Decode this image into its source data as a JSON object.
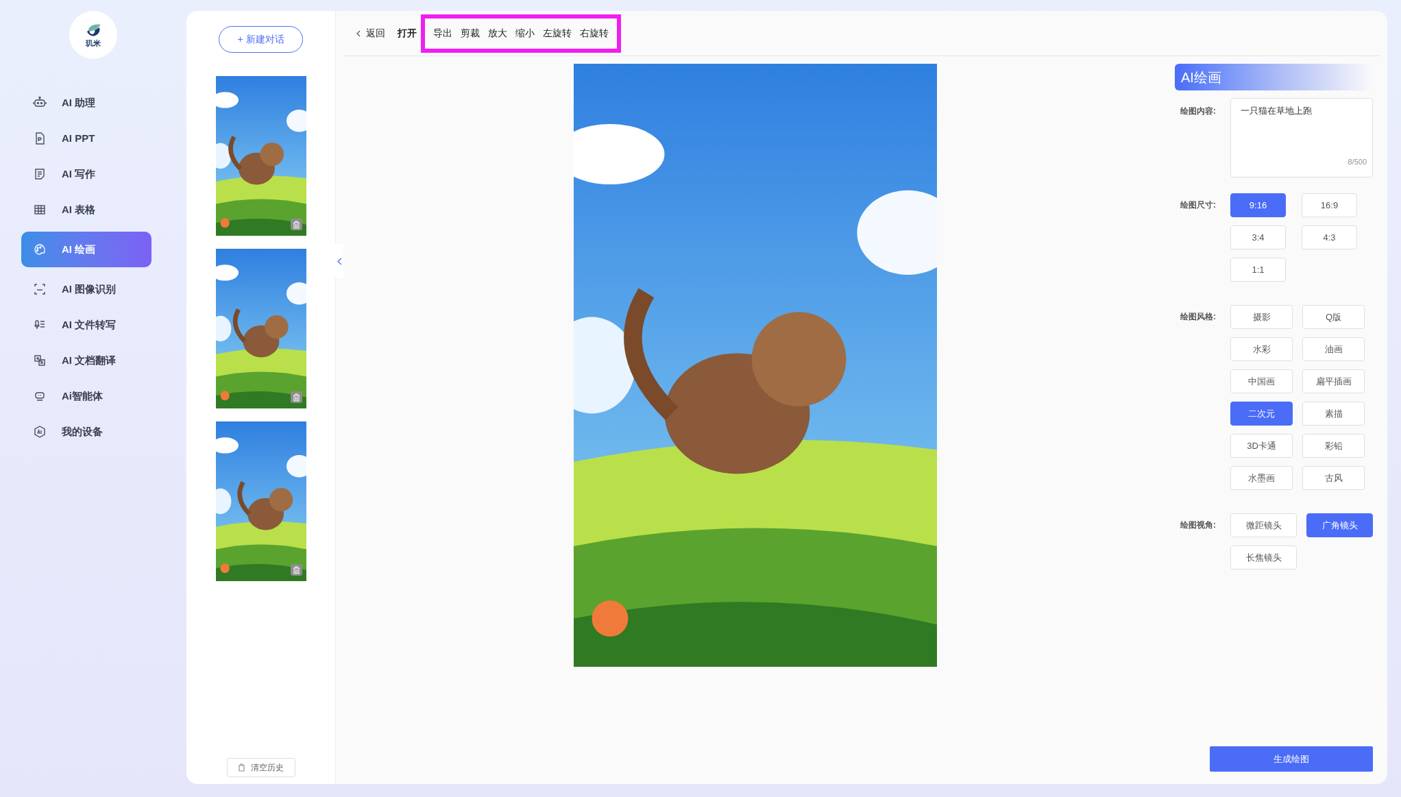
{
  "logo": {
    "text": "玑米"
  },
  "sidebar": {
    "items": [
      {
        "label": "AI 助理",
        "selected": false
      },
      {
        "label": "AI PPT",
        "selected": false
      },
      {
        "label": "AI 写作",
        "selected": false
      },
      {
        "label": "AI 表格",
        "selected": false
      },
      {
        "label": "AI 绘画",
        "selected": true
      },
      {
        "label": "AI 图像识别",
        "selected": false
      },
      {
        "label": "AI 文件转写",
        "selected": false
      },
      {
        "label": "AI 文档翻译",
        "selected": false
      },
      {
        "label": "Ai智能体",
        "selected": false
      },
      {
        "label": "我的设备",
        "selected": false
      }
    ]
  },
  "history": {
    "new_chat": "+ 新建对话",
    "clear": "清空历史"
  },
  "toolbar": {
    "back": "返回",
    "items": [
      {
        "label": "打开",
        "bold": true,
        "highlighted": false
      },
      {
        "label": "导出",
        "bold": false,
        "highlighted": true
      },
      {
        "label": "剪裁",
        "bold": false,
        "highlighted": true
      },
      {
        "label": "放大",
        "bold": false,
        "highlighted": true
      },
      {
        "label": "缩小",
        "bold": false,
        "highlighted": true
      },
      {
        "label": "左旋转",
        "bold": false,
        "highlighted": true
      },
      {
        "label": "右旋转",
        "bold": false,
        "highlighted": true
      }
    ]
  },
  "panel": {
    "title": "AI绘画",
    "content": {
      "label": "绘图内容:",
      "value": "一只猫在草地上跑",
      "counter": "8/500"
    },
    "groups": [
      {
        "label": "绘图尺寸:",
        "options": [
          {
            "label": "9:16",
            "selected": true
          },
          {
            "label": "16:9",
            "selected": false
          },
          {
            "label": "3:4",
            "selected": false
          },
          {
            "label": "4:3",
            "selected": false
          },
          {
            "label": "1:1",
            "selected": false
          }
        ]
      },
      {
        "label": "绘图风格:",
        "options": [
          {
            "label": "摄影",
            "selected": false
          },
          {
            "label": "Q版",
            "selected": false
          },
          {
            "label": "水彩",
            "selected": false
          },
          {
            "label": "油画",
            "selected": false
          },
          {
            "label": "中国画",
            "selected": false
          },
          {
            "label": "扁平插画",
            "selected": false
          },
          {
            "label": "二次元",
            "selected": true
          },
          {
            "label": "素描",
            "selected": false
          },
          {
            "label": "3D卡通",
            "selected": false
          },
          {
            "label": "彩铅",
            "selected": false
          },
          {
            "label": "水墨画",
            "selected": false
          },
          {
            "label": "古风",
            "selected": false
          }
        ]
      },
      {
        "label": "绘图视角:",
        "options": [
          {
            "label": "微距镜头",
            "selected": false
          },
          {
            "label": "广角镜头",
            "selected": true
          },
          {
            "label": "长焦镜头",
            "selected": false
          }
        ]
      }
    ],
    "generate": "生成绘图"
  }
}
